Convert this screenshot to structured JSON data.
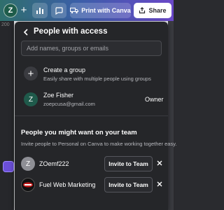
{
  "toolbar": {
    "avatar_initial": "Z",
    "print_label": "Print with Canva",
    "share_label": "Share"
  },
  "editor": {
    "stub_number": "200"
  },
  "panel": {
    "title": "People with access",
    "search_placeholder": "Add names, groups or emails",
    "create_group": {
      "title": "Create a group",
      "subtitle": "Easily share with multiple people using groups"
    },
    "owner": {
      "initial": "Z",
      "name": "Zoe Fisher",
      "email": "zoepcusa@gmail.com",
      "role": "Owner"
    },
    "suggestions": {
      "title": "People you might want on your team",
      "subtitle": "Invite people to Personal on Canva to make working together easy.",
      "people": [
        {
          "initial": "Z",
          "name": "ZOemf222",
          "invite_label": "Invite to Team"
        },
        {
          "name": "Fuel Web Marketing",
          "invite_label": "Invite to Team"
        }
      ]
    }
  },
  "colors": {
    "panel_bg": "#252629",
    "accent_gradient_start": "#2f6f6c",
    "accent_gradient_end": "#6a48c8"
  }
}
